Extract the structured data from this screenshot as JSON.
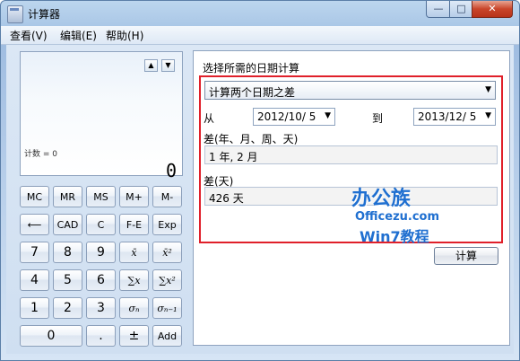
{
  "window": {
    "title": "计算器",
    "min_glyph": "—",
    "max_glyph": "□",
    "close_glyph": "✕"
  },
  "menu": {
    "items": [
      "查看(V)",
      "编辑(E)",
      "帮助(H)"
    ]
  },
  "display": {
    "up_arrow": "▲",
    "down_arrow": "▼",
    "memory_count": "计数 = 0",
    "value": "0"
  },
  "keypad": {
    "rows": [
      [
        "MC",
        "MR",
        "MS",
        "M+",
        "M-"
      ],
      [
        "⟵",
        "CAD",
        "C",
        "F-E",
        "Exp"
      ],
      [
        "7",
        "8",
        "9",
        "x̄",
        "x̄²"
      ],
      [
        "4",
        "5",
        "6",
        "∑x",
        "∑x²"
      ],
      [
        "1",
        "2",
        "3",
        "σₙ",
        "σₙ₋₁"
      ]
    ],
    "bottom": [
      "0",
      ".",
      "±",
      "Add"
    ]
  },
  "date_panel": {
    "title": "选择所需的日期计算",
    "mode": "计算两个日期之差",
    "from_label": "从",
    "from_date": "2012/10/ 5",
    "to_label": "到",
    "to_date": "2013/12/ 5",
    "diff_label": "差(年、月、周、天)",
    "diff_value": "1 年, 2 月",
    "days_label": "差(天)",
    "days_value": "426 天",
    "compute_button": "计算"
  },
  "watermark": {
    "logo": "办公族",
    "site": "Officezu.com",
    "subtitle": "Win7教程"
  },
  "colors": {
    "highlight_border": "#e0202a",
    "watermark": "#1f6fd0"
  }
}
